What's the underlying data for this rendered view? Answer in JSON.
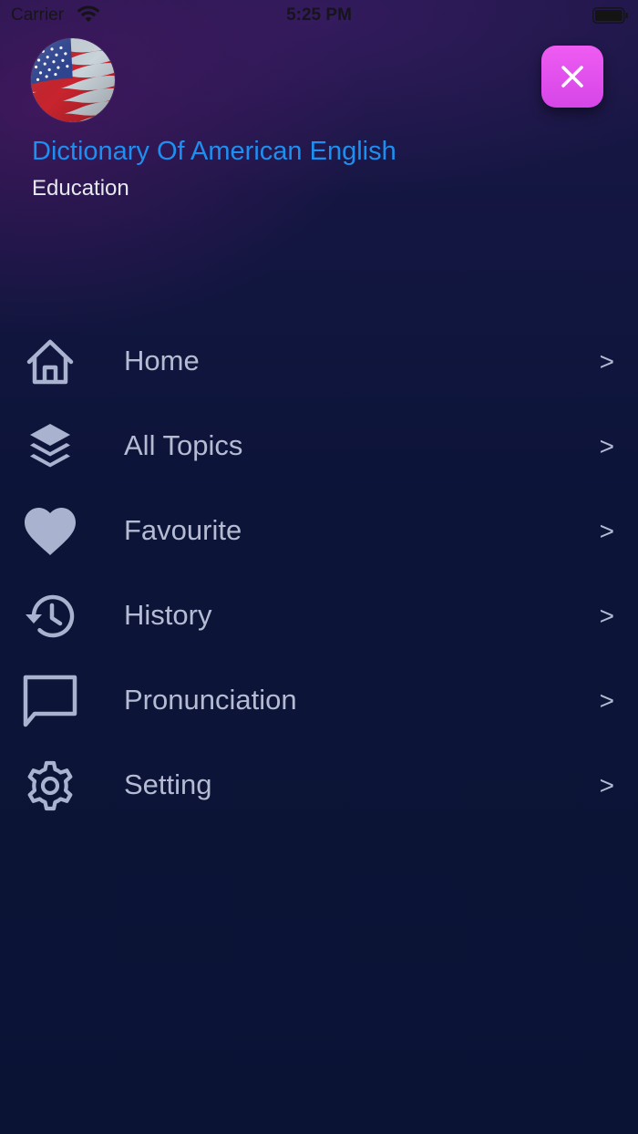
{
  "status_bar": {
    "carrier": "Carrier",
    "time": "5:25 PM"
  },
  "header": {
    "avatar_icon": "american-flag-icon",
    "title": "Dictionary Of American English",
    "category": "Education",
    "close_icon": "close-icon"
  },
  "menu": {
    "items": [
      {
        "label": "Home",
        "icon": "home-icon",
        "arrow": ">"
      },
      {
        "label": "All Topics",
        "icon": "layers-icon",
        "arrow": ">"
      },
      {
        "label": "Favourite",
        "icon": "heart-icon",
        "arrow": ">"
      },
      {
        "label": "History",
        "icon": "history-icon",
        "arrow": ">"
      },
      {
        "label": "Pronunciation",
        "icon": "chat-bubble-icon",
        "arrow": ">"
      },
      {
        "label": "Setting",
        "icon": "gear-icon",
        "arrow": ">"
      }
    ]
  },
  "colors": {
    "title": "#1d8ff0",
    "menu_text": "#b4bbd2",
    "icon": "#a9b3d0",
    "close_button": "#e052ee",
    "background": "#0b1335"
  }
}
